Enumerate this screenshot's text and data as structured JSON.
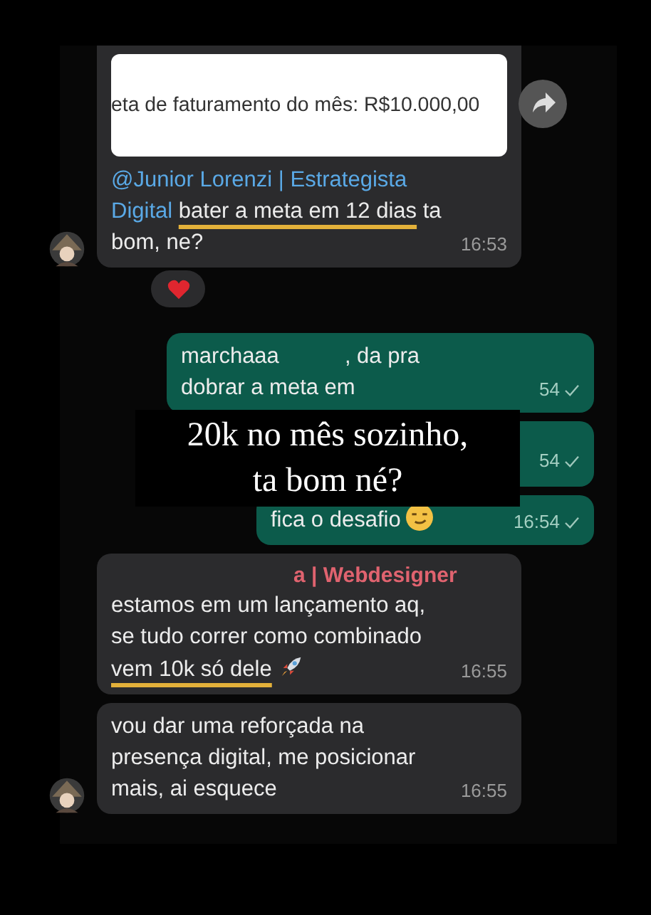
{
  "messages": [
    {
      "kind": "incoming",
      "quote_card": {
        "text": "eta de faturamento do mês: R$10.000,00"
      },
      "segments": [
        {
          "kind": "mention",
          "text": "@Junior Lorenzi | Estrategista Digital"
        },
        {
          "kind": "highlight",
          "text": "bater a meta em 12 dias"
        },
        {
          "kind": "plain",
          "text": "ta bom, ne?"
        }
      ],
      "time": "16:53",
      "avatar": true,
      "reacted": true,
      "forward": true
    },
    {
      "kind": "outgoing",
      "segments": [
        {
          "kind": "plain",
          "text": "marchaaa"
        },
        {
          "kind": "after_redaction",
          "text": ", da pra dobrar a meta em"
        }
      ],
      "time": "54",
      "sent": true
    },
    {
      "kind": "outgoing",
      "time": "54",
      "sent": true
    },
    {
      "kind": "outgoing",
      "segments": [
        {
          "kind": "plain",
          "text": "fica o desafio"
        },
        {
          "kind": "smirk_emoji"
        }
      ],
      "time": "16:54",
      "sent": true
    },
    {
      "kind": "incoming",
      "sender": "a | Webdesigner",
      "segments": [
        {
          "kind": "plain",
          "text": "estamos em um lançamento aq, se tudo correr como combinado"
        },
        {
          "kind": "highlight",
          "text": "vem 10k só dele"
        },
        {
          "kind": "rocket_emoji"
        }
      ],
      "time": "16:55",
      "avatar": false
    },
    {
      "kind": "incoming",
      "segments": [
        {
          "kind": "plain",
          "text": "vou dar uma reforçada na presença digital, me posicionar mais, ai esquece"
        }
      ],
      "time": "16:55",
      "avatar": true
    }
  ],
  "overlay_caption": {
    "lines": [
      "20k no mês sozinho,",
      "ta bom né?"
    ]
  }
}
